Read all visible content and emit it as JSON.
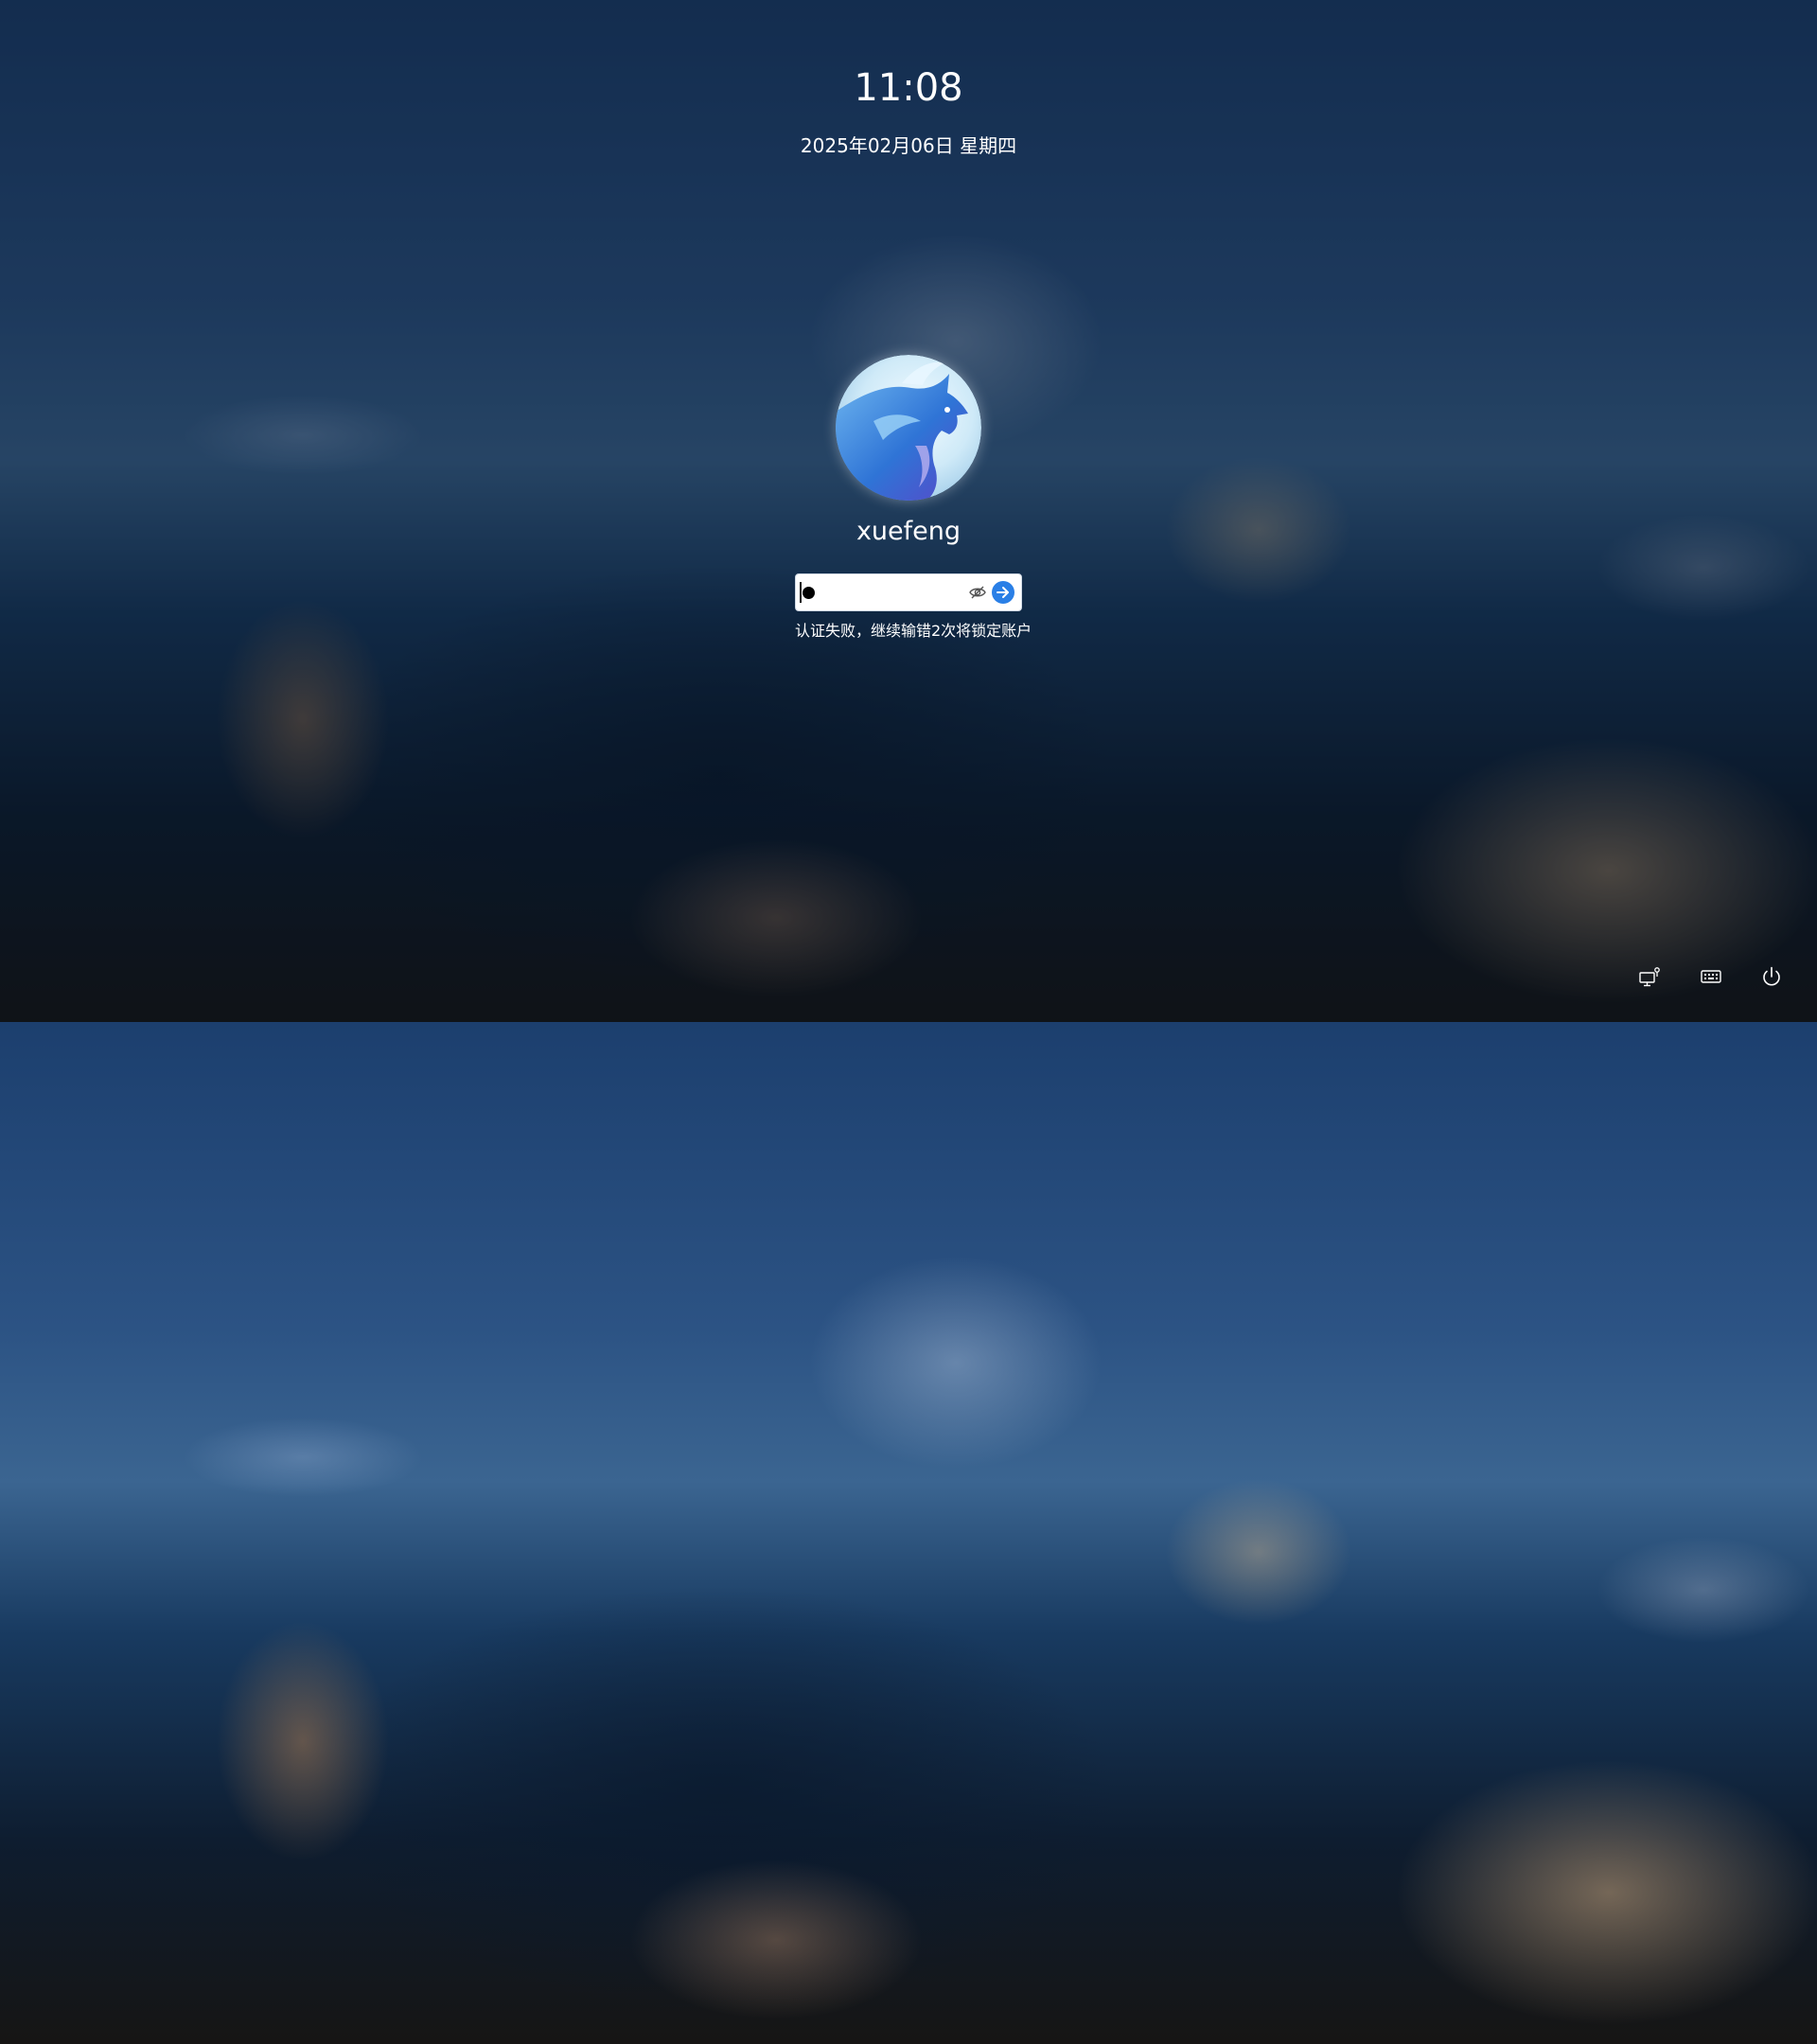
{
  "lock_screen": {
    "time": "11:08",
    "date": "2025年02月06日 星期四",
    "username": "xuefeng",
    "password": {
      "masked_char_count": 1,
      "show_password_icon": "eye-slash-icon",
      "submit_icon": "arrow-right-icon"
    },
    "error_message": "认证失败，继续输错2次将锁定账户",
    "tray": [
      {
        "icon": "network-display-icon"
      },
      {
        "icon": "keyboard-icon"
      },
      {
        "icon": "power-icon"
      }
    ]
  },
  "colors": {
    "accent": "#2a7fe6",
    "text": "#ffffff",
    "input_bg": "#ffffff"
  }
}
